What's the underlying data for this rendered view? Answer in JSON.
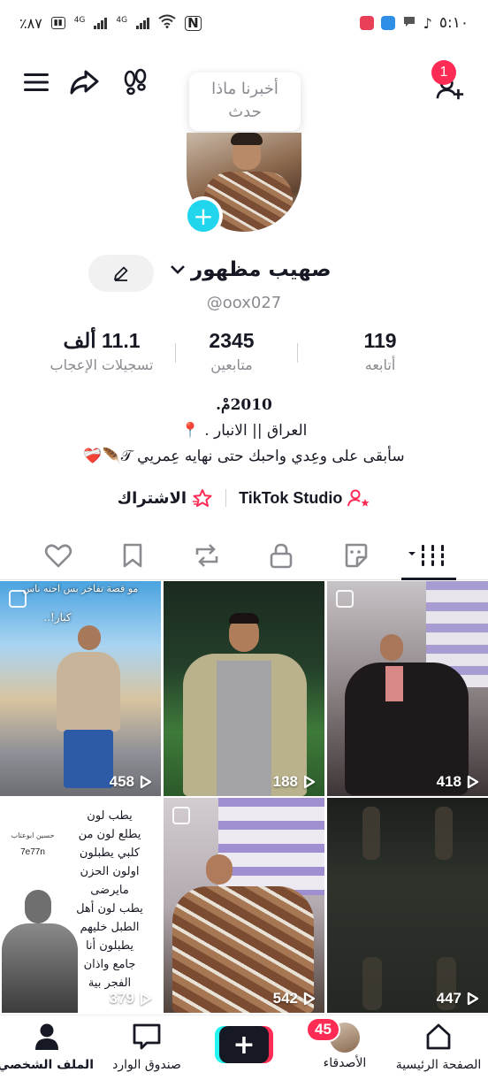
{
  "status_bar": {
    "battery": "٪٨٧",
    "network_1": "4G",
    "network_2": "4G",
    "time": "٥:١٠"
  },
  "header": {
    "tooltip_line1": "أخبرنا ماذا",
    "tooltip_line2": "حدث",
    "notification_count": "1"
  },
  "profile": {
    "display_name": "صهيب مظهور",
    "username": "@oox027"
  },
  "stats": {
    "likes_value": "11.1 ألف",
    "likes_label": "تسجيلات الإعجاب",
    "followers_value": "2345",
    "followers_label": "متابعين",
    "following_value": "119",
    "following_label": "أتابعه"
  },
  "bio": {
    "line1": "2010مْ.",
    "line2": "العراق || الانبار . 📍",
    "line3": "سأبقى على وعِدي واحبك حتى نهايه عِمريي 𝒯🪶❤️‍🩹"
  },
  "links": {
    "studio": "TikTok Studio",
    "subscribe": "الاشتراك"
  },
  "grid": {
    "videos": [
      {
        "views": "418"
      },
      {
        "views": "188"
      },
      {
        "views": "458",
        "caption_line1": "مو قصة تفاخر بس احنه ناس",
        "caption_line2": "كبار!.."
      },
      {
        "views": "447"
      },
      {
        "views": "542"
      },
      {
        "views": "379",
        "poem": [
          "يطب لون",
          "يطلع لون من",
          "كلبي يطبلون",
          "اولون الحزن",
          "مايرضى",
          "يطب لون أهل",
          "الطبل خليهم",
          "يطبلون أنا",
          "جامع واذان",
          "الفجر بية"
        ],
        "tag_name": "حسين ابوعتاب",
        "tag_handle": "7e77n"
      }
    ]
  },
  "bottom_nav": {
    "home": "الصفحة الرئيسية",
    "friends": "الأصدقاء",
    "friends_badge": "45",
    "inbox": "صندوق الوارد",
    "profile": "الملف الشخصي"
  },
  "colors": {
    "accent_red": "#fe2c55",
    "accent_cyan": "#25f4ee",
    "add_avatar_blue": "#20d5ec",
    "text_primary": "#161823",
    "text_secondary": "#8a8b91"
  }
}
